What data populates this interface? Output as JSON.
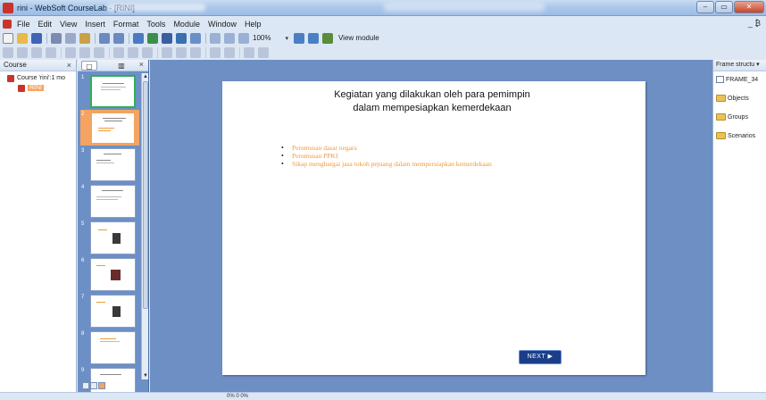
{
  "window": {
    "title": "rini - WebSoft CourseLab - [RINI]",
    "minimize": "–",
    "restore": "▭",
    "close": "✕"
  },
  "menu": {
    "items": [
      "File",
      "Edit",
      "View",
      "Insert",
      "Format",
      "Tools",
      "Module",
      "Window",
      "Help"
    ],
    "right": "_ ₿"
  },
  "toolbar": {
    "zoom": "100%",
    "zoom_caret": "▾",
    "view_module": "View module"
  },
  "course_panel": {
    "title": "Course",
    "close": "×",
    "tree": [
      {
        "label": "Course 'rini':1 mo"
      },
      {
        "label": "RINI"
      }
    ]
  },
  "slides_panel": {
    "close": "×",
    "thumb_numbers": [
      "1",
      "2",
      "3",
      "4",
      "5",
      "6",
      "7",
      "8",
      "9"
    ]
  },
  "slide": {
    "title_line1": "Kegiatan yang dilakukan oleh para pemimpin",
    "title_line2": "dalam mempesiapkan kemerdekaan",
    "bullets": [
      "Perumusan dasar negara",
      "Perumusan PPKI",
      "Sikap menghargai jasa tokoh pejuang dalam mempersiapkan kemerdekaan"
    ],
    "next_label": "NEXT ▶"
  },
  "right_panel": {
    "title": "Frame structu ▾",
    "items": [
      "FRAME_34",
      "Objects",
      "Groups",
      "Scenarios"
    ]
  },
  "status": {
    "text": "0%  0 0%"
  },
  "colors": {
    "canvas_bg": "#6e8fc4",
    "accent_orange": "#f4a460",
    "bullet_text": "#ee9a3c",
    "next_button": "#1a3e8a"
  }
}
